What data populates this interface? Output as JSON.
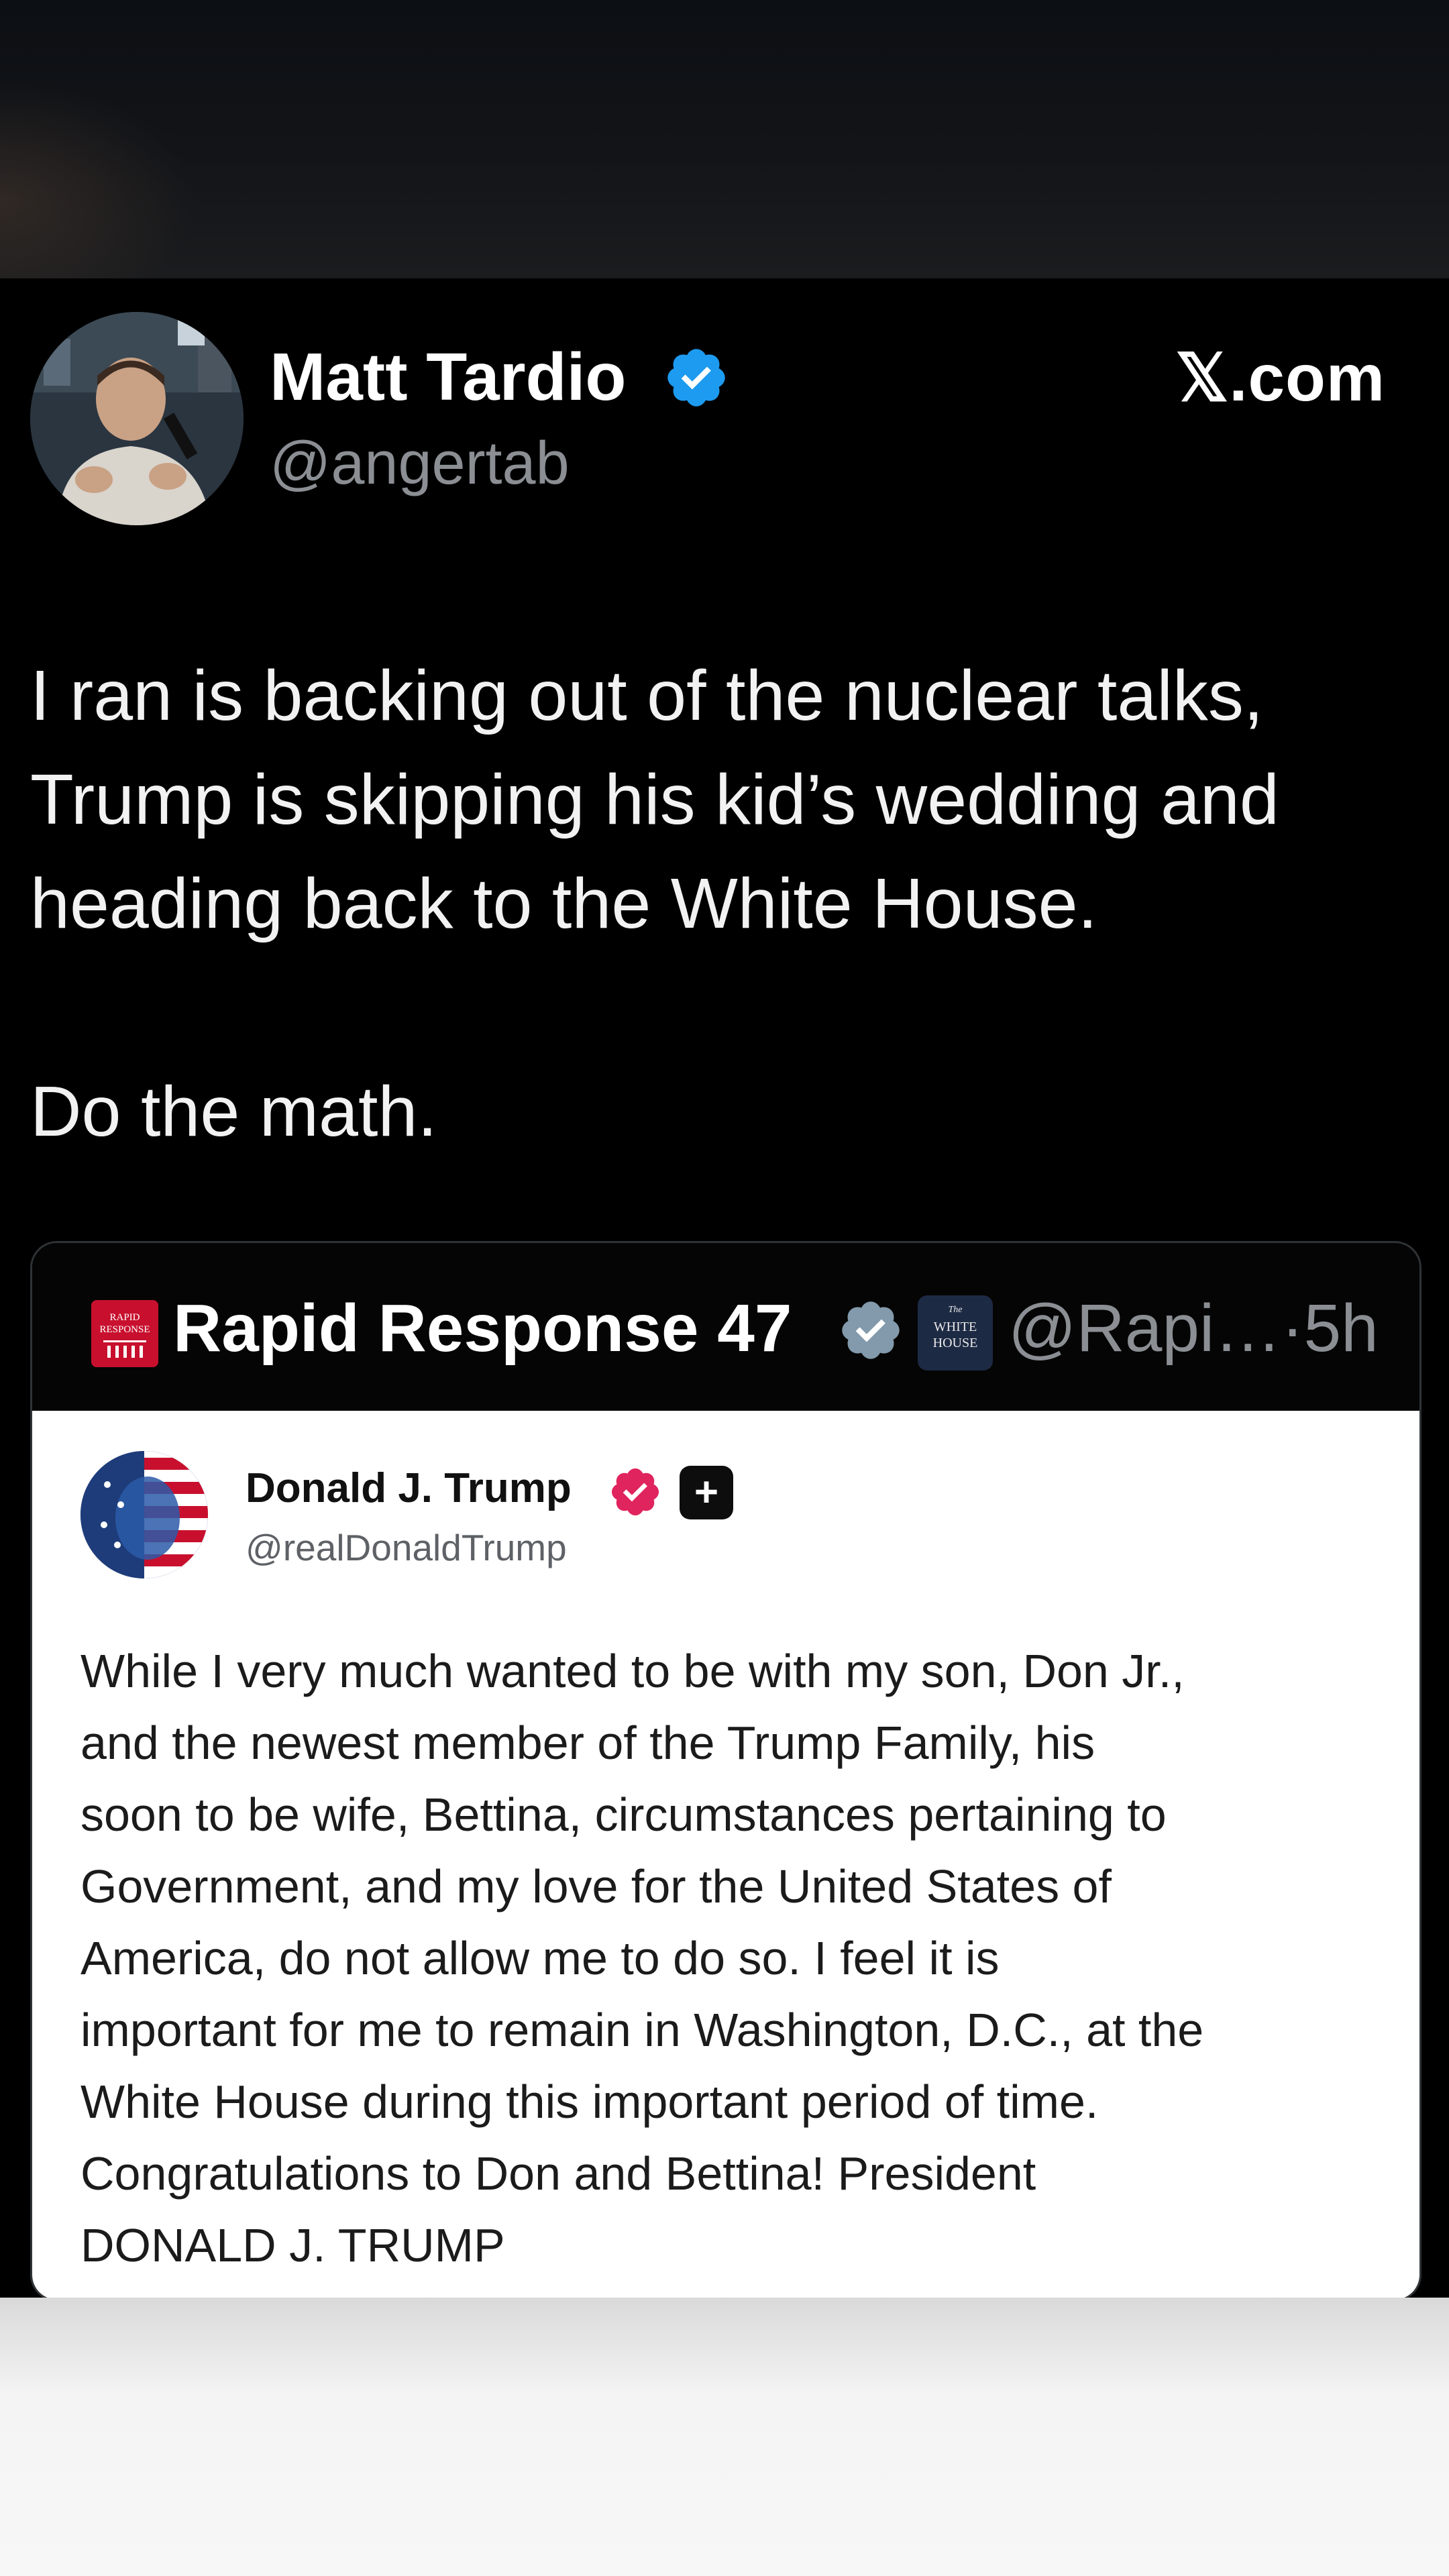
{
  "post": {
    "author_name": "Matt Tardio",
    "author_handle": "@angertab",
    "brand": "𝕏.com",
    "text_lines": [
      "I ran is backing out of the nuclear talks,",
      "Trump is skipping his kid’s wedding and",
      "heading back to the White House."
    ],
    "text_line2": "Do the math."
  },
  "quote": {
    "name": "Rapid Response 47",
    "logo_text": [
      "RAPID",
      "RESPONSE"
    ],
    "badge_text": [
      "The",
      "WHITE",
      "HOUSE"
    ],
    "handle_time": "@Rapi…·5h"
  },
  "embedded": {
    "name": "Donald J. Trump",
    "handle": "@realDonaldTrump",
    "plus_symbol": "+",
    "lines": [
      "While I very much wanted to be with my son, Don Jr.,",
      "and the newest member of the Trump Family, his",
      "soon to be wife, Bettina, circumstances pertaining to",
      "Government, and my love for the United States of",
      "America, do not allow me to do so. I feel it is",
      "important for me to remain in Washington, D.C., at the",
      "White House during this important period of time.",
      "Congratulations to Don and Bettina! President",
      "DONALD J. TRUMP"
    ]
  },
  "colors": {
    "verified_blue": "#1d9bf0",
    "verified_pink": "#e0245e",
    "rr_red": "#c8102e"
  }
}
